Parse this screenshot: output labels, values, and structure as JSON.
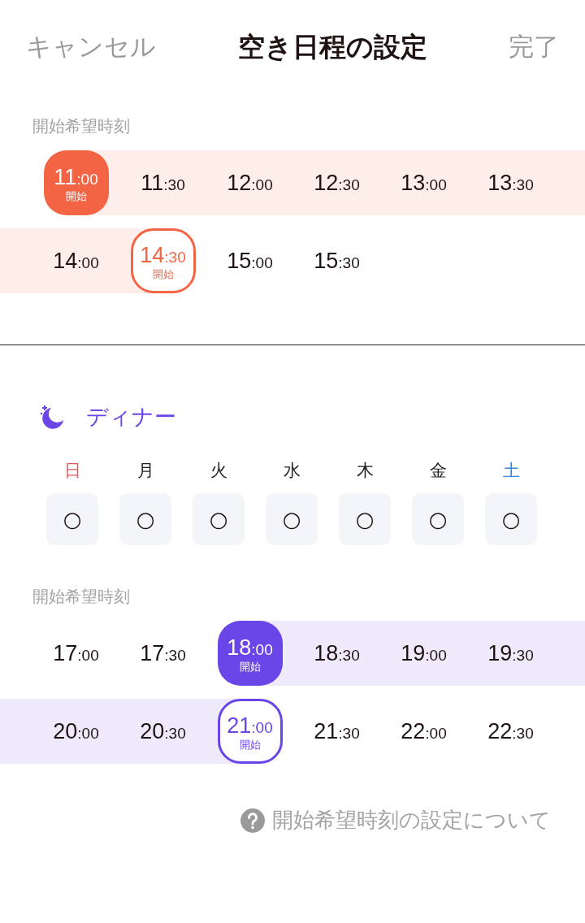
{
  "header": {
    "cancel": "キャンセル",
    "title": "空き日程の設定",
    "done": "完了"
  },
  "sections": [
    {
      "color": "#f26444",
      "time_label": "開始希望時刻",
      "slots": [
        {
          "hour": "11",
          "minute": ":00",
          "kind": "filled",
          "badge": "開始",
          "in_range": true
        },
        {
          "hour": "11",
          "minute": ":30",
          "kind": "plain",
          "in_range": true
        },
        {
          "hour": "12",
          "minute": ":00",
          "kind": "plain",
          "in_range": true
        },
        {
          "hour": "12",
          "minute": ":30",
          "kind": "plain",
          "in_range": true
        },
        {
          "hour": "13",
          "minute": ":00",
          "kind": "plain",
          "in_range": true
        },
        {
          "hour": "13",
          "minute": ":30",
          "kind": "plain",
          "in_range": true
        },
        {
          "hour": "14",
          "minute": ":00",
          "kind": "plain",
          "in_range": true
        },
        {
          "hour": "14",
          "minute": ":30",
          "kind": "outlined",
          "badge": "開始",
          "in_range": true
        },
        {
          "hour": "15",
          "minute": ":00",
          "kind": "plain",
          "in_range": false
        },
        {
          "hour": "15",
          "minute": ":30",
          "kind": "plain",
          "in_range": false
        }
      ]
    },
    {
      "color": "#6a45e8",
      "title": "ディナー",
      "days": [
        {
          "label": "日",
          "color": "#e05a5a",
          "mark": "○"
        },
        {
          "label": "月",
          "color": "#222222",
          "mark": "○"
        },
        {
          "label": "火",
          "color": "#222222",
          "mark": "○"
        },
        {
          "label": "水",
          "color": "#222222",
          "mark": "○"
        },
        {
          "label": "木",
          "color": "#222222",
          "mark": "○"
        },
        {
          "label": "金",
          "color": "#222222",
          "mark": "○"
        },
        {
          "label": "土",
          "color": "#3a86d8",
          "mark": "○"
        }
      ],
      "time_label": "開始希望時刻",
      "slots": [
        {
          "hour": "17",
          "minute": ":00",
          "kind": "plain",
          "in_range": false
        },
        {
          "hour": "17",
          "minute": ":30",
          "kind": "plain",
          "in_range": false
        },
        {
          "hour": "18",
          "minute": ":00",
          "kind": "filled",
          "badge": "開始",
          "in_range": true
        },
        {
          "hour": "18",
          "minute": ":30",
          "kind": "plain",
          "in_range": true
        },
        {
          "hour": "19",
          "minute": ":00",
          "kind": "plain",
          "in_range": true
        },
        {
          "hour": "19",
          "minute": ":30",
          "kind": "plain",
          "in_range": true
        },
        {
          "hour": "20",
          "minute": ":00",
          "kind": "plain",
          "in_range": true
        },
        {
          "hour": "20",
          "minute": ":30",
          "kind": "plain",
          "in_range": true
        },
        {
          "hour": "21",
          "minute": ":00",
          "kind": "outlined",
          "badge": "開始",
          "in_range": true
        },
        {
          "hour": "21",
          "minute": ":30",
          "kind": "plain",
          "in_range": false
        },
        {
          "hour": "22",
          "minute": ":00",
          "kind": "plain",
          "in_range": false
        },
        {
          "hour": "22",
          "minute": ":30",
          "kind": "plain",
          "in_range": false
        }
      ]
    }
  ],
  "help_link": "開始希望時刻の設定について"
}
